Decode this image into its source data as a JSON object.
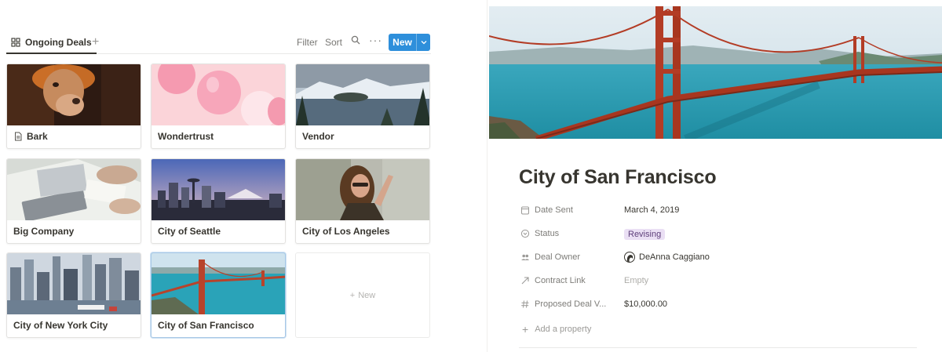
{
  "gallery": {
    "view_tab": "Ongoing Deals",
    "toolbar": {
      "filter": "Filter",
      "sort": "Sort",
      "new_label": "New"
    },
    "cards": [
      {
        "title": "Bark",
        "cover": "dog-icon"
      },
      {
        "title": "Wondertrust",
        "cover": "balloons"
      },
      {
        "title": "Vendor",
        "cover": "lake-mountains"
      },
      {
        "title": "Big Company",
        "cover": "laptops-meeting"
      },
      {
        "title": "City of Seattle",
        "cover": "seattle-skyline"
      },
      {
        "title": "City of Los Angeles",
        "cover": "woman-portrait"
      },
      {
        "title": "City of New York City",
        "cover": "new-york-skyline"
      },
      {
        "title": "City of San Francisco",
        "cover": "golden-gate-bridge"
      }
    ],
    "add_new_label": "New"
  },
  "page": {
    "title": "City of San Francisco",
    "properties": [
      {
        "key": "Date Sent",
        "value": "March 4, 2019",
        "icon": "calendar-icon"
      },
      {
        "key": "Status",
        "value": "Revising",
        "icon": "select-icon"
      },
      {
        "key": "Deal Owner",
        "value": "DeAnna Caggiano",
        "icon": "people-icon"
      },
      {
        "key": "Contract Link",
        "value": "Empty",
        "icon": "link-arrow-icon"
      },
      {
        "key": "Proposed Deal V...",
        "value": "$10,000.00",
        "icon": "number-icon"
      }
    ],
    "add_property": "Add a property"
  },
  "colors": {
    "accent": "#2e8fdb",
    "tag_bg": "#eadff4",
    "tag_text": "#5e3f7a"
  }
}
